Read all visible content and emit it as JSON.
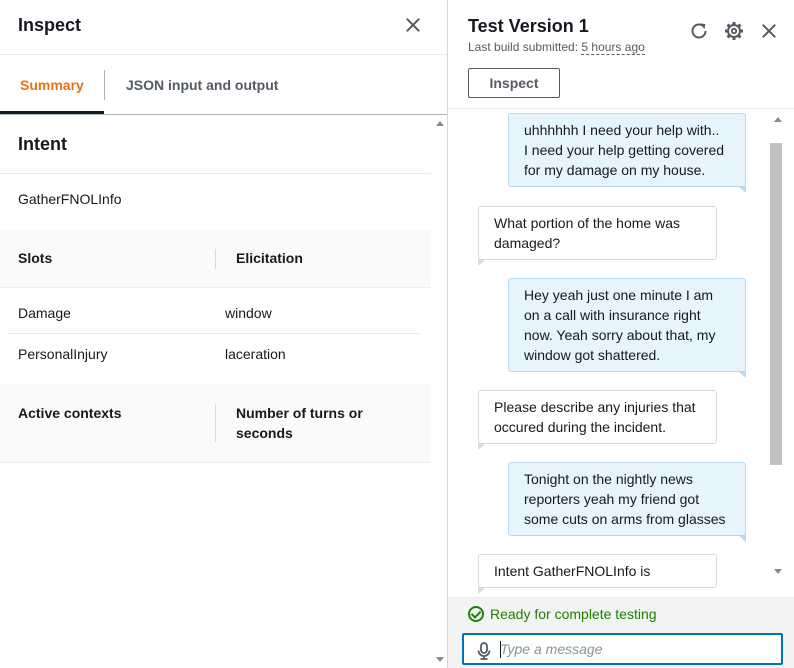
{
  "inspect_panel": {
    "title": "Inspect",
    "tabs": [
      {
        "label": "Summary",
        "active": true
      },
      {
        "label": "JSON input and output",
        "active": false
      }
    ],
    "intent": {
      "heading": "Intent",
      "name": "GatherFNOLInfo"
    },
    "slots_table": {
      "col1": "Slots",
      "col2": "Elicitation",
      "rows": [
        {
          "slot": "Damage",
          "value": "window"
        },
        {
          "slot": "PersonalInjury",
          "value": "laceration"
        }
      ]
    },
    "contexts_table": {
      "col1": "Active contexts",
      "col2_line1": "Number of turns or",
      "col2_line2": "seconds"
    }
  },
  "test_panel": {
    "title": "Test Version 1",
    "build_label": "Last build submitted:",
    "build_time": "5 hours ago",
    "inspect_button": "Inspect",
    "messages": [
      {
        "from": "user",
        "lines": [
          "uhhhhhh I need your help with..",
          "I need your help getting covered",
          "for my damage on my house."
        ]
      },
      {
        "from": "bot",
        "lines": [
          "What portion of the home was",
          "damaged?"
        ]
      },
      {
        "from": "user",
        "lines": [
          "Hey yeah just one minute I am",
          "on a call with insurance right",
          "now. Yeah sorry about that, my",
          "window got shattered."
        ]
      },
      {
        "from": "bot",
        "lines": [
          "Please describe any injuries that",
          "occured during the incident."
        ]
      },
      {
        "from": "user",
        "lines": [
          "Tonight on the nightly news",
          "reporters yeah my friend got",
          "some cuts on arms from glasses"
        ]
      },
      {
        "from": "bot",
        "lines": [
          "Intent GatherFNOLInfo is"
        ]
      }
    ],
    "status": "Ready for complete testing",
    "input_placeholder": "Type a message",
    "input_value": ""
  },
  "colors": {
    "accent_tab": "#ec7211",
    "status_green": "#1d8102",
    "focus_blue": "#0073bb",
    "user_bubble": "#e6f4fd"
  },
  "icons": {
    "close": "close-icon",
    "refresh": "refresh-icon",
    "settings": "gear-icon",
    "mic": "microphone-icon",
    "status": "check-circle-icon"
  }
}
